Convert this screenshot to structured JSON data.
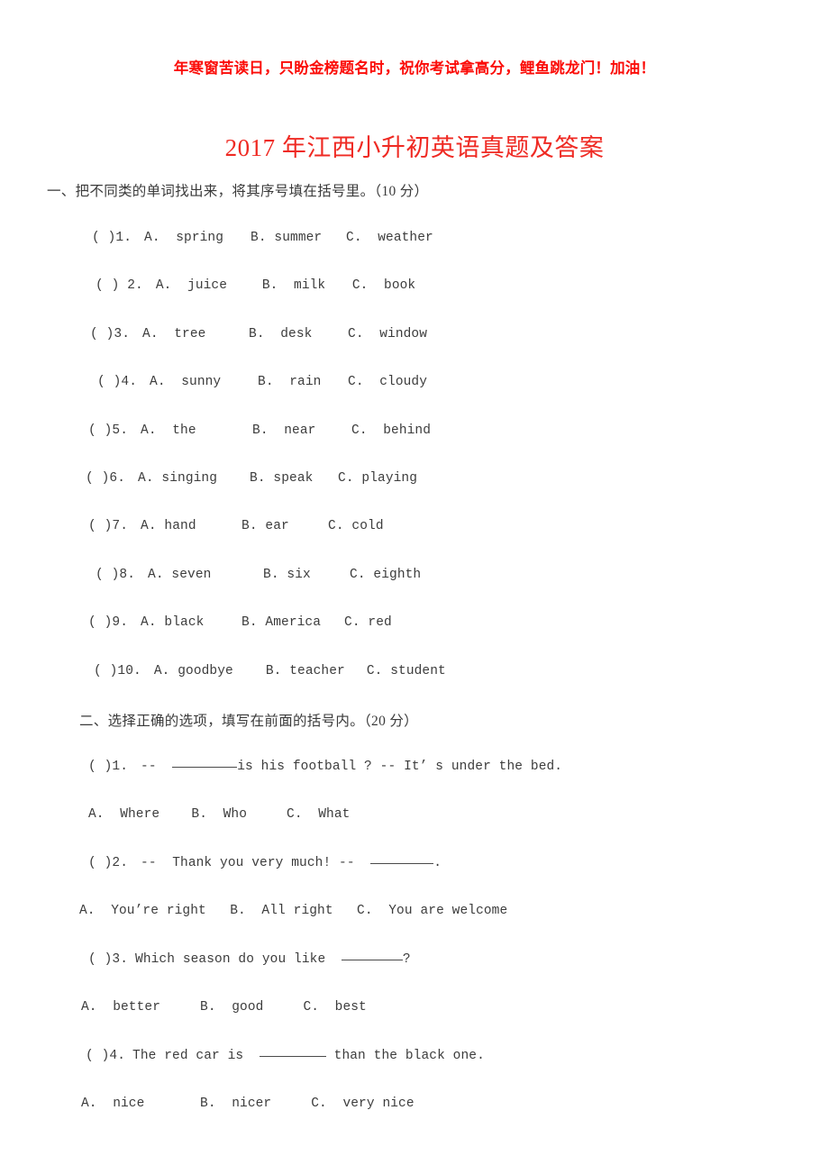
{
  "banner": {
    "text": "年寒窗苦读日，只盼金榜题名时，祝你考试拿高分，鲤鱼跳龙门！加油！",
    "color": "#fb0c08"
  },
  "title": {
    "text": "2017 年江西小升初英语真题及答案",
    "color": "#ef2a23"
  },
  "sections": [
    {
      "heading": "一、把不同类的单词找出来，将其序号填在括号里。（10 分）",
      "score": "10 分",
      "questions": [
        {
          "mark": "( )1.",
          "a": "A.  spring",
          "b": "B. summer",
          "c": "C.  weather"
        },
        {
          "mark": "( ) 2.",
          "a": "A.  juice",
          "b": "B.  milk",
          "c": "C.  book"
        },
        {
          "mark": "( )3.",
          "a": "A.  tree",
          "b": "B.  desk",
          "c": "C.  window"
        },
        {
          "mark": "( )4.",
          "a": "A.  sunny",
          "b": "B.  rain",
          "c": "C.  cloudy"
        },
        {
          "mark": "( )5.",
          "a": "A.  the",
          "b": "B.  near",
          "c": "C.  behind"
        },
        {
          "mark": "( )6.",
          "a": "A. singing",
          "b": "B. speak",
          "c": "C. playing"
        },
        {
          "mark": "( )7.",
          "a": "A. hand",
          "b": "B. ear",
          "c": "C. cold"
        },
        {
          "mark": "( )8.",
          "a": "A. seven",
          "b": "B. six",
          "c": "C. eighth"
        },
        {
          "mark": "( )9.",
          "a": "A. black",
          "b": "B. America",
          "c": "C. red"
        },
        {
          "mark": "( )10.",
          "a": "A. goodbye",
          "b": "B. teacher",
          "c": "C. student"
        }
      ]
    },
    {
      "heading": "二、选择正确的选项，填写在前面的括号内。（20 分）",
      "score": "20 分",
      "questions": [
        {
          "mark": "( )1.",
          "stem_before": "--  ",
          "stem_after": "is his football ? -- It’ s under the bed.",
          "options": "A.  Where    B.  Who     C.  What"
        },
        {
          "mark": "( )2.",
          "stem_before": "--  Thank you very much! --  ",
          "stem_after": ".",
          "options": "A.  You’re right   B.  All right   C.  You are welcome"
        },
        {
          "mark": "( )3.",
          "stem_before": "Which season do you like  ",
          "stem_after": "?",
          "options": "A.  better     B.  good     C.  best"
        },
        {
          "mark": "( )4.",
          "stem_before": "The red car is  ",
          "stem_after": " than the black one.",
          "options": "A.  nice       B.  nicer     C.  very nice"
        }
      ]
    }
  ]
}
